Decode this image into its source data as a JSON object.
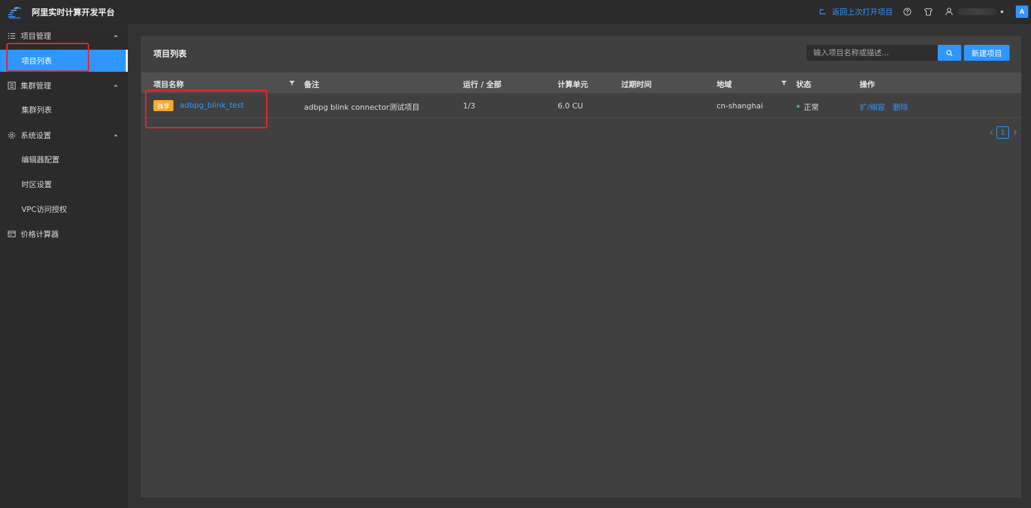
{
  "header": {
    "title": "阿里实时计算开发平台",
    "return_link": "返回上次打开项目",
    "lang_label": "A"
  },
  "sidebar": {
    "groups": [
      {
        "label": "项目管理",
        "icon": "list-icon",
        "items": [
          {
            "label": "项目列表",
            "active": true
          }
        ]
      },
      {
        "label": "集群管理",
        "icon": "cluster-icon",
        "items": [
          {
            "label": "集群列表",
            "active": false
          }
        ]
      },
      {
        "label": "系统设置",
        "icon": "gear-icon",
        "items": [
          {
            "label": "编辑器配置",
            "active": false
          },
          {
            "label": "时区设置",
            "active": false
          },
          {
            "label": "VPC访问授权",
            "active": false
          }
        ]
      },
      {
        "label": "价格计算器",
        "icon": "calculator-icon",
        "items": []
      }
    ]
  },
  "main": {
    "title": "项目列表",
    "search": {
      "placeholder": "输入项目名称或描述..."
    },
    "new_button": "新建项目",
    "table": {
      "headers": [
        "项目名称",
        "备注",
        "运行 / 全部",
        "计算单元",
        "过期时间",
        "地域",
        "状态",
        "操作"
      ],
      "rows": [
        {
          "tag": "独享",
          "name": "adbpg_blink_test",
          "note": "adbpg blink connector测试项目",
          "running": "1/3",
          "cu": "6.0 CU",
          "expire": "",
          "region": "cn-shanghai",
          "status": "正常",
          "actions": [
            "扩/缩容",
            "删除"
          ]
        }
      ]
    },
    "pagination": {
      "current": "1"
    }
  },
  "colors": {
    "accent": "#2f95ff",
    "tag": "#f7a92c",
    "status_ok": "#2fc25b",
    "annotation": "#e0282e"
  }
}
